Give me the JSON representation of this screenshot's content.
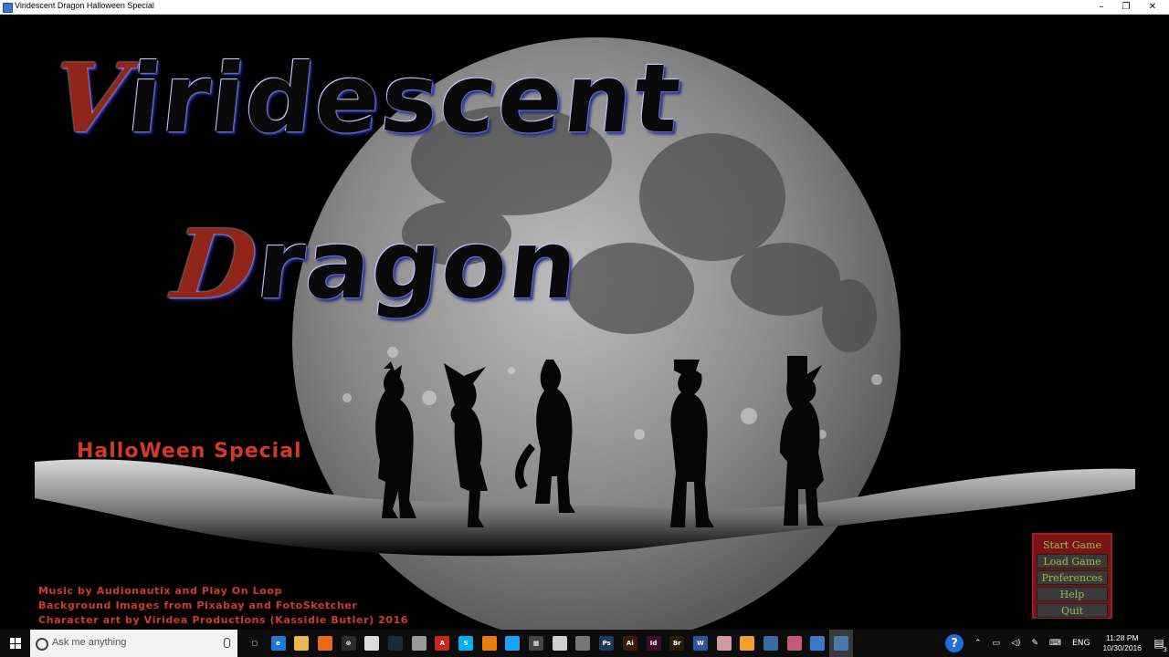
{
  "window": {
    "title": "Viridescent Dragon Halloween Special",
    "minimize": "–",
    "restore": "❐",
    "close": "✕"
  },
  "game": {
    "title_line1_cap": "V",
    "title_line1_rest": "iridescent",
    "title_line2_cap": "D",
    "title_line2_rest": "ragon",
    "subtitle": "HalloWeen Special",
    "credits": [
      "Music by Audionautix and Play On Loop",
      "Background Images from Pixabay and FotoSketcher",
      "Character art by Viridea Productions (Kassidie Butler) 2016"
    ],
    "menu": {
      "start": "Start Game",
      "load": "Load Game",
      "preferences": "Preferences",
      "help": "Help",
      "quit": "Quit"
    }
  },
  "taskbar": {
    "search_placeholder": "Ask me anything",
    "apps": [
      {
        "icon": "task-view-icon",
        "color": "#0c0c0c",
        "glyph": "▢"
      },
      {
        "icon": "edge-icon",
        "color": "#1e78d4",
        "glyph": "e"
      },
      {
        "icon": "file-explorer-icon",
        "color": "#e8b84a",
        "glyph": ""
      },
      {
        "icon": "firefox-icon",
        "color": "#e66b1a",
        "glyph": ""
      },
      {
        "icon": "xbox-icon",
        "color": "#2b2b2b",
        "glyph": "⊗"
      },
      {
        "icon": "app-icon",
        "color": "#dcdcdc",
        "glyph": ""
      },
      {
        "icon": "steam-icon",
        "color": "#1b2838",
        "glyph": ""
      },
      {
        "icon": "app2-icon",
        "color": "#9a9a9a",
        "glyph": ""
      },
      {
        "icon": "pdf-icon",
        "color": "#c4291c",
        "glyph": "A"
      },
      {
        "icon": "skype-icon",
        "color": "#00aff0",
        "glyph": "S"
      },
      {
        "icon": "blender-icon",
        "color": "#e87d0d",
        "glyph": ""
      },
      {
        "icon": "twitter-icon",
        "color": "#1da1f2",
        "glyph": ""
      },
      {
        "icon": "calculator-icon",
        "color": "#444444",
        "glyph": "▦"
      },
      {
        "icon": "app3-icon",
        "color": "#cfcfcf",
        "glyph": ""
      },
      {
        "icon": "app4-icon",
        "color": "#777777",
        "glyph": ""
      },
      {
        "icon": "photoshop-icon",
        "color": "#1c3b5a",
        "glyph": "Ps"
      },
      {
        "icon": "illustrator-icon",
        "color": "#3b1a0a",
        "glyph": "Ai"
      },
      {
        "icon": "indesign-icon",
        "color": "#3b0f2a",
        "glyph": "Id"
      },
      {
        "icon": "bridge-icon",
        "color": "#2b1a04",
        "glyph": "Br"
      },
      {
        "icon": "word-icon",
        "color": "#2b579a",
        "glyph": "W"
      },
      {
        "icon": "character-icon",
        "color": "#d09aa0",
        "glyph": ""
      },
      {
        "icon": "app5-icon",
        "color": "#f0a030",
        "glyph": ""
      },
      {
        "icon": "photos-icon",
        "color": "#3a6aa8",
        "glyph": ""
      },
      {
        "icon": "app6-icon",
        "color": "#c45a7a",
        "glyph": ""
      },
      {
        "icon": "document-icon",
        "color": "#3a7ac8",
        "glyph": ""
      },
      {
        "icon": "python-icon",
        "color": "#4a78a8",
        "glyph": ""
      }
    ],
    "help_glyph": "?",
    "tray_lang": "ENG",
    "time": "11:28 PM",
    "date": "10/30/2016",
    "notifications": "3"
  }
}
